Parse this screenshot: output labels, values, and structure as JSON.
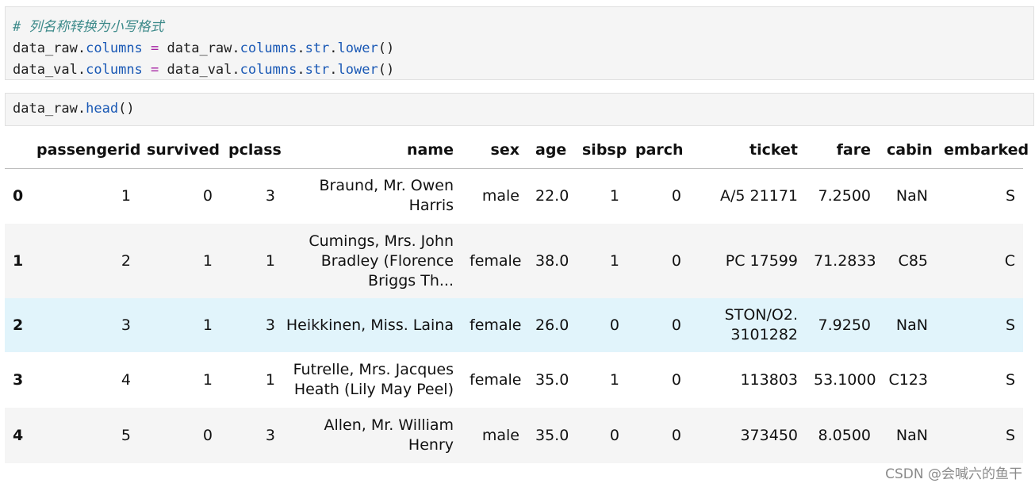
{
  "cell1": {
    "comment": "# 列名称转换为小写格式",
    "line2": {
      "var": "data_raw",
      "dot1": ".",
      "attr1": "columns",
      "eq": " = ",
      "var2": "data_raw",
      "dot2": ".",
      "attr2": "columns",
      "dot3": ".",
      "attr3": "str",
      "dot4": ".",
      "attr4": "lower",
      "paren": "()"
    },
    "line3": {
      "var": "data_val",
      "dot1": ".",
      "attr1": "columns",
      "eq": " = ",
      "var2": "data_val",
      "dot2": ".",
      "attr2": "columns",
      "dot3": ".",
      "attr3": "str",
      "dot4": ".",
      "attr4": "lower",
      "paren": "()"
    }
  },
  "cell2": {
    "var": "data_raw",
    "dot": ".",
    "attr": "head",
    "paren": "()"
  },
  "table": {
    "columns": [
      "passengerid",
      "survived",
      "pclass",
      "name",
      "sex",
      "age",
      "sibsp",
      "parch",
      "ticket",
      "fare",
      "cabin",
      "embarked"
    ],
    "rows": [
      {
        "index": "0",
        "cells": [
          "1",
          "0",
          "3",
          "Braund, Mr. Owen Harris",
          "male",
          "22.0",
          "1",
          "0",
          "A/5 21171",
          "7.2500",
          "NaN",
          "S"
        ]
      },
      {
        "index": "1",
        "cells": [
          "2",
          "1",
          "1",
          "Cumings, Mrs. John Bradley (Florence Briggs Th...",
          "female",
          "38.0",
          "1",
          "0",
          "PC 17599",
          "71.2833",
          "C85",
          "C"
        ]
      },
      {
        "index": "2",
        "cells": [
          "3",
          "1",
          "3",
          "Heikkinen, Miss. Laina",
          "female",
          "26.0",
          "0",
          "0",
          "STON/O2. 3101282",
          "7.9250",
          "NaN",
          "S"
        ]
      },
      {
        "index": "3",
        "cells": [
          "4",
          "1",
          "1",
          "Futrelle, Mrs. Jacques Heath (Lily May Peel)",
          "female",
          "35.0",
          "1",
          "0",
          "113803",
          "53.1000",
          "C123",
          "S"
        ]
      },
      {
        "index": "4",
        "cells": [
          "5",
          "0",
          "3",
          "Allen, Mr. William Henry",
          "male",
          "35.0",
          "0",
          "0",
          "373450",
          "8.0500",
          "NaN",
          "S"
        ]
      }
    ]
  },
  "watermark": "CSDN @会喊六的鱼干"
}
